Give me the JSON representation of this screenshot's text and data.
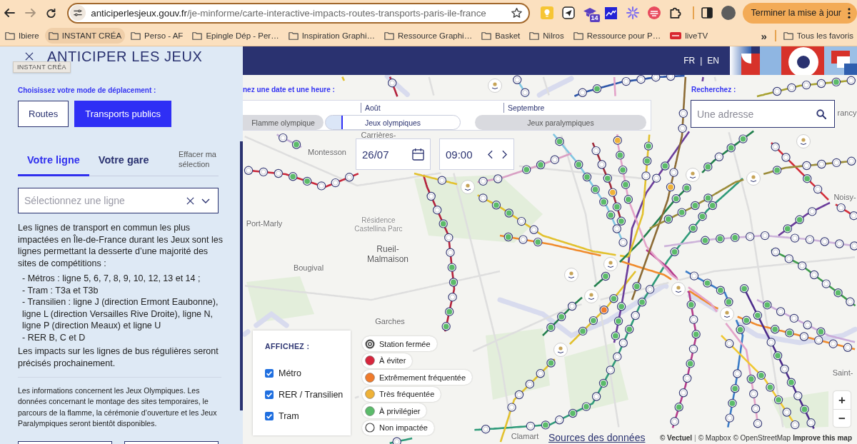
{
  "browser": {
    "nav_buttons": [
      {
        "kind": "back",
        "disabled": false
      },
      {
        "kind": "forward",
        "disabled": true
      },
      {
        "kind": "reload",
        "disabled": false
      }
    ],
    "address_bar": {
      "host": "anticiperlesjeux.gouv.fr",
      "path": "/je-minforme/carte-interactive-impacts-routes-transports-paris-ile-france"
    },
    "extensions": [
      {
        "kind": "bulb"
      },
      {
        "kind": "plane"
      },
      {
        "kind": "cap",
        "badge": "14"
      },
      {
        "kind": "chart"
      },
      {
        "kind": "sparkle"
      },
      {
        "kind": "stripes"
      },
      {
        "kind": "puzzle"
      }
    ],
    "update_button": "Terminer la mise à jour",
    "bookmarks": [
      {
        "label": "Ibiere",
        "kind": "folder",
        "hovered": false
      },
      {
        "label": "INSTANT CRÉA",
        "kind": "folder",
        "hovered": true
      },
      {
        "label": "Perso - AF",
        "kind": "folder",
        "hovered": false
      },
      {
        "label": "Epingle Dép - Per…",
        "kind": "folder",
        "hovered": false
      },
      {
        "label": "Inspiration Graphi…",
        "kind": "folder",
        "hovered": false
      },
      {
        "label": "Ressource Graphi…",
        "kind": "folder",
        "hovered": false
      },
      {
        "label": "Basket",
        "kind": "folder",
        "hovered": false
      },
      {
        "label": "Nilros",
        "kind": "folder",
        "hovered": false
      },
      {
        "label": "Ressource pour P…",
        "kind": "folder",
        "hovered": false
      },
      {
        "label": "liveTV",
        "kind": "live",
        "hovered": false
      }
    ],
    "more_bookmarks": "»",
    "all_bookmarks": "Tous les favoris",
    "tooltip": "INSTANT CRÉA"
  },
  "sidebar": {
    "title": "ANTICIPER LES JEUX",
    "mode_prompt": "Choisissez votre mode de déplacement :",
    "modes": [
      {
        "label": "Routes",
        "selected": false
      },
      {
        "label": "Transports publics",
        "selected": true
      }
    ],
    "tabs": [
      {
        "label": "Votre ligne",
        "selected": true
      },
      {
        "label": "Votre gare",
        "selected": false
      }
    ],
    "clear_link": "Effacer ma sélection",
    "line_select": {
      "placeholder": "Sélectionnez une ligne"
    },
    "intro": "Les lignes de transport en commun les plus impactées en Île-de-France durant les Jeux sont les lignes permettant la desserte d’une majorité des sites de compétitions :",
    "list": [
      "- Métros : ligne 5, 6, 7, 8, 9, 10, 12, 13 et 14 ;",
      "- Tram : T3a et T3b",
      "- Transilien : ligne J (direction Ermont Eaubonne), ligne L (direction Versailles Rive Droite), ligne N, ligne P (direction Meaux) et ligne U",
      "- RER B, C et D"
    ],
    "outro": "Les impacts sur les lignes de bus régulières seront précisés prochainement.",
    "notice": "Les informations concernent les Jeux Olympiques. Les données concernant le montage des sites temporaires, le parcours de la flamme, la cérémonie d’ouverture et les Jeux Paralympiques seront bientôt disponibles."
  },
  "map": {
    "languages": [
      "FR",
      "EN"
    ],
    "language_separator": "|",
    "date_prompt": "nez une date et une heure :",
    "timeline": {
      "months": [
        "Août",
        "Septembre"
      ],
      "periods": [
        {
          "label": "Flamme olympique",
          "selected": false
        },
        {
          "label": "Jeux olympiques",
          "selected": true
        },
        {
          "label": "Jeux paralympiques",
          "selected": false
        }
      ]
    },
    "date": {
      "value": "26/07"
    },
    "time": {
      "value": "09:00"
    },
    "search": {
      "prompt": "Recherchez :",
      "placeholder": "Une adresse"
    },
    "place_labels": [
      {
        "text": "rancy",
        "kind": "town"
      },
      {
        "text": "Carrières-",
        "kind": "town"
      },
      {
        "text": "Montesson",
        "kind": "town"
      },
      {
        "text": "Noisy-",
        "kind": "town"
      },
      {
        "text": "Port-Marly",
        "kind": "town"
      },
      {
        "text": "Résidence Castellina Parc",
        "kind": "locality"
      },
      {
        "text": "Rueil-Malmaison",
        "kind": "city"
      },
      {
        "text": "Bougival",
        "kind": "town"
      },
      {
        "text": "Garches",
        "kind": "town"
      },
      {
        "text": "Saint-",
        "kind": "town"
      },
      {
        "text": "Clamart",
        "kind": "town"
      }
    ],
    "display": {
      "title": "AFFICHEZ :",
      "options": [
        {
          "label": "Métro",
          "checked": true
        },
        {
          "label": "RER / Transilien",
          "checked": true
        },
        {
          "label": "Tram",
          "checked": true
        }
      ]
    },
    "legend": [
      {
        "label": "Station fermée",
        "kind": "closed",
        "color": "#4d4d4d"
      },
      {
        "label": "À éviter",
        "kind": "dot",
        "color": "#d7263d"
      },
      {
        "label": "Extrêmement fréquentée",
        "kind": "dot",
        "color": "#f07b2c"
      },
      {
        "label": "Très fréquentée",
        "kind": "dot",
        "color": "#efb238"
      },
      {
        "label": "À privilégier",
        "kind": "dot",
        "color": "#5bbb6a"
      },
      {
        "label": "Non impactée",
        "kind": "empty"
      }
    ],
    "sources_link": "Sources des données",
    "attribution": [
      {
        "kind": "link",
        "text": "© Vectuel",
        "bold": true
      },
      {
        "kind": "separator",
        "text": "|",
        "bold": false
      },
      {
        "kind": "link",
        "text": "© Mapbox",
        "bold": false
      },
      {
        "kind": "link",
        "text": "© OpenStreetMap",
        "bold": false
      },
      {
        "kind": "link",
        "text": "Improve this map",
        "bold": true
      }
    ],
    "zoom": [
      "+",
      "−"
    ]
  }
}
